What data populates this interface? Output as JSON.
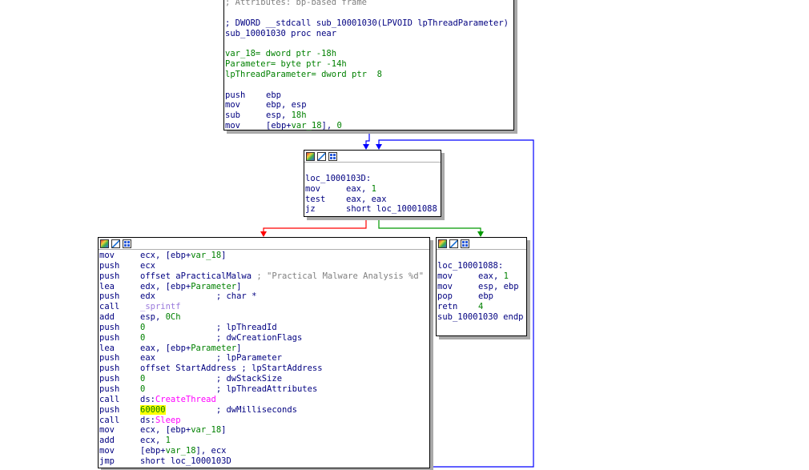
{
  "colors": {
    "code_text": "#000080",
    "immediate": "#008000",
    "comment": "#808080",
    "import": "#ff00ff",
    "library_func": "#9a7adc",
    "highlight": "#ffff00",
    "edge_flow": "#0000ff",
    "edge_true": "#009900",
    "edge_false": "#ff0000"
  },
  "header_icons": [
    "palette-icon",
    "edit-icon",
    "grid-icon"
  ],
  "top_block": {
    "attributes_comment": "; Attributes: bp-based frame",
    "signature": "; DWORD __stdcall sub_10001030(LPVOID lpThreadParameter)",
    "proc": "sub_10001030 proc near",
    "var_18": "var_18= dword ptr -18h",
    "parameter": "Parameter= byte ptr -14h",
    "lpthreadparameter": "lpThreadParameter= dword ptr  8",
    "ins": [
      {
        "m": "push",
        "o": "ebp"
      },
      {
        "m": "mov",
        "o": "ebp, esp"
      },
      {
        "m": "sub",
        "o1": "esp, ",
        "o2": "18h"
      },
      {
        "m": "mov",
        "o1": "[ebp+",
        "o2": "var_18",
        "o3": "], ",
        "o4": "0"
      }
    ]
  },
  "loop_block": {
    "label": "loc_1000103D:",
    "ins": [
      {
        "m": "mov",
        "o1": "eax, ",
        "o2": "1"
      },
      {
        "m": "test",
        "o": "eax, eax"
      },
      {
        "m": "jz",
        "o": "short loc_10001088"
      }
    ]
  },
  "body_block": {
    "l1": {
      "m": "mov",
      "o1": "ecx, [ebp+",
      "o2": "var_18",
      "o3": "]"
    },
    "l2": {
      "m": "push",
      "o": "ecx"
    },
    "l3": {
      "m": "push",
      "o": "offset aPracticalMalwa",
      "c": " ; \"Practical Malware Analysis %d\""
    },
    "l4": {
      "m": "lea",
      "o1": "edx, [ebp+",
      "o2": "Parameter",
      "o3": "]"
    },
    "l5": {
      "m": "push",
      "o": "edx",
      "c": "            ; char *"
    },
    "l6": {
      "m": "call",
      "o": "_sprintf"
    },
    "l7": {
      "m": "add",
      "o1": "esp, ",
      "o2": "0Ch"
    },
    "l8": {
      "m": "push",
      "o": "0",
      "c": "              ; lpThreadId"
    },
    "l9": {
      "m": "push",
      "o": "0",
      "c": "              ; dwCreationFlags"
    },
    "l10": {
      "m": "lea",
      "o1": "eax, [ebp+",
      "o2": "Parameter",
      "o3": "]"
    },
    "l11": {
      "m": "push",
      "o": "eax",
      "c": "            ; lpParameter"
    },
    "l12": {
      "m": "push",
      "o": "offset StartAddress",
      "c": " ; lpStartAddress"
    },
    "l13": {
      "m": "push",
      "o": "0",
      "c": "              ; dwStackSize"
    },
    "l14": {
      "m": "push",
      "o": "0",
      "c": "              ; lpThreadAttributes"
    },
    "l15": {
      "m": "call",
      "o1": "ds:",
      "o2": "CreateThread"
    },
    "l16": {
      "m": "push",
      "o": "60000",
      "c": "          ; dwMilliseconds"
    },
    "l17": {
      "m": "call",
      "o1": "ds:",
      "o2": "Sleep"
    },
    "l18": {
      "m": "mov",
      "o1": "ecx, [ebp+",
      "o2": "var_18",
      "o3": "]"
    },
    "l19": {
      "m": "add",
      "o1": "ecx, ",
      "o2": "1"
    },
    "l20": {
      "m": "mov",
      "o1": "[ebp+",
      "o2": "var_18",
      "o3": "], ecx"
    },
    "l21": {
      "m": "jmp",
      "o": "short loc_1000103D"
    }
  },
  "exit_block": {
    "label": "loc_10001088:",
    "ins": [
      {
        "m": "mov",
        "o1": "eax, ",
        "o2": "1"
      },
      {
        "m": "mov",
        "o": "esp, ebp"
      },
      {
        "m": "pop",
        "o": "ebp"
      },
      {
        "m": "retn",
        "o2": "4"
      }
    ],
    "endp": "sub_10001030 endp"
  }
}
